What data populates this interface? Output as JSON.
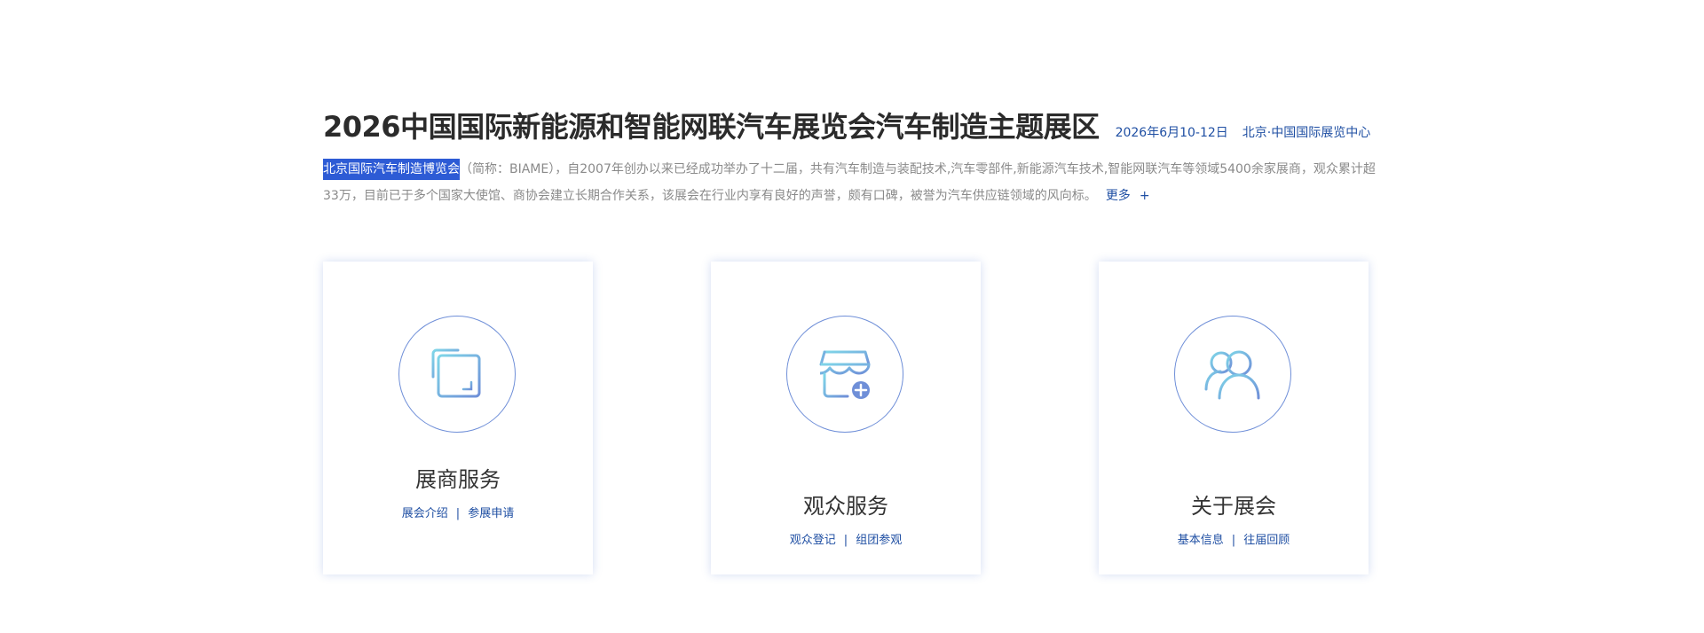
{
  "header": {
    "title": "2026中国国际新能源和智能网联汽车展览会汽车制造主题展区",
    "date": "2026年6月10-12日",
    "venue": "北京·中国国际展览中心"
  },
  "intro": {
    "highlight": "北京国际汽车制造博览会",
    "text": "（简称：BIAME），自2007年创办以来已经成功举办了十二届，共有汽车制造与装配技术,汽车零部件,新能源汽车技术,智能网联汽车等领域5400余家展商，观众累计超33万，目前已于多个国家大使馆、商协会建立长期合作关系，该展会在行业内享有良好的声誉，颇有口碑，被誉为汽车供应链领域的风向标。",
    "more_label": "更多",
    "plus_label": "+"
  },
  "cards": [
    {
      "icon": "copy-squares-icon",
      "title": "展商服务",
      "link1": "展会介绍",
      "link2": "参展申请"
    },
    {
      "icon": "storefront-add-icon",
      "title": "观众服务",
      "link1": "观众登记",
      "link2": "组团参观"
    },
    {
      "icon": "users-icon",
      "title": "关于展会",
      "link1": "基本信息",
      "link2": "往届回顾"
    }
  ],
  "colors": {
    "accent": "#1f4fa3",
    "highlight_bg": "#2d5bd5",
    "icon_gradient_start": "#7fd6e8",
    "icon_gradient_end": "#6f8fd8",
    "body_text": "#8a8a8a",
    "title_text": "#2b2b2b"
  }
}
